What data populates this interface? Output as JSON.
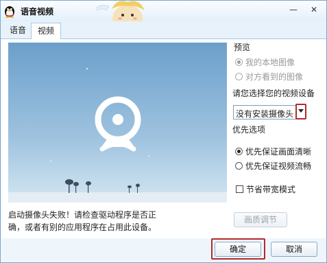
{
  "window": {
    "title": "语音视频"
  },
  "tabs": [
    {
      "label": "语音",
      "active": false
    },
    {
      "label": "视频",
      "active": true
    }
  ],
  "preview": {
    "section_label": "预览",
    "options": [
      {
        "label": "我的本地图像",
        "checked": true,
        "disabled": true
      },
      {
        "label": "对方看到的图像",
        "checked": false,
        "disabled": true
      }
    ]
  },
  "device": {
    "prompt": "请您选择您的视频设备",
    "selected": "没有安装摄像头"
  },
  "priority": {
    "section_label": "优先选项",
    "options": [
      {
        "label": "优先保证画面清晰",
        "checked": true
      },
      {
        "label": "优先保证视频流畅",
        "checked": false
      }
    ]
  },
  "bandwidth": {
    "label": "节省带宽模式",
    "checked": false
  },
  "quality_button": {
    "label": "画质调节"
  },
  "status": {
    "line1": "启动摄像头失败！请检查驱动程序是否正",
    "line2": "确，或者有别的应用程序在占用此设备。"
  },
  "footer": {
    "ok_label": "确定",
    "cancel_label": "取消"
  },
  "colors": {
    "accent_red": "#b22a2a",
    "sky_top": "#6fa3cd",
    "sky_bottom": "#cfe3f1"
  }
}
